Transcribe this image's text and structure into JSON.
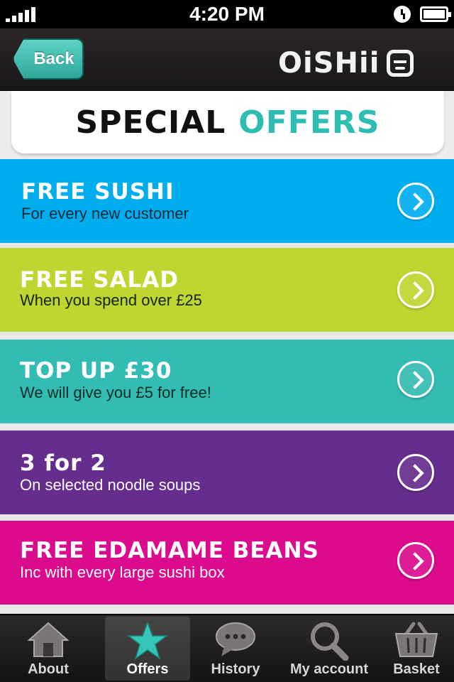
{
  "status_bar": {
    "time": "4:20 PM"
  },
  "nav": {
    "back_label": "Back",
    "logo_text": "OiSHii"
  },
  "page_title": {
    "part1": "SPECIAL",
    "part2": "OFFERS"
  },
  "offers": [
    {
      "title": "FREE SUSHI",
      "subtitle": "For every new customer",
      "color": "#00aeef"
    },
    {
      "title": "FREE SALAD",
      "subtitle": "When you spend over £25",
      "color": "#bfd630"
    },
    {
      "title": "TOP UP £30",
      "subtitle": "We will give you £5 for free!",
      "color": "#33bcb4"
    },
    {
      "title": "3 for 2",
      "subtitle": "On selected noodle soups",
      "color": "#652d8d"
    },
    {
      "title": "FREE EDAMAME BEANS",
      "subtitle": "Inc with every large sushi box",
      "color": "#dc0b8e"
    }
  ],
  "tabs": [
    {
      "label": "About",
      "icon": "home-icon"
    },
    {
      "label": "Offers",
      "icon": "star-icon",
      "active": true
    },
    {
      "label": "History",
      "icon": "speech-bubble-icon"
    },
    {
      "label": "My account",
      "icon": "search-icon"
    },
    {
      "label": "Basket",
      "icon": "basket-icon"
    }
  ]
}
